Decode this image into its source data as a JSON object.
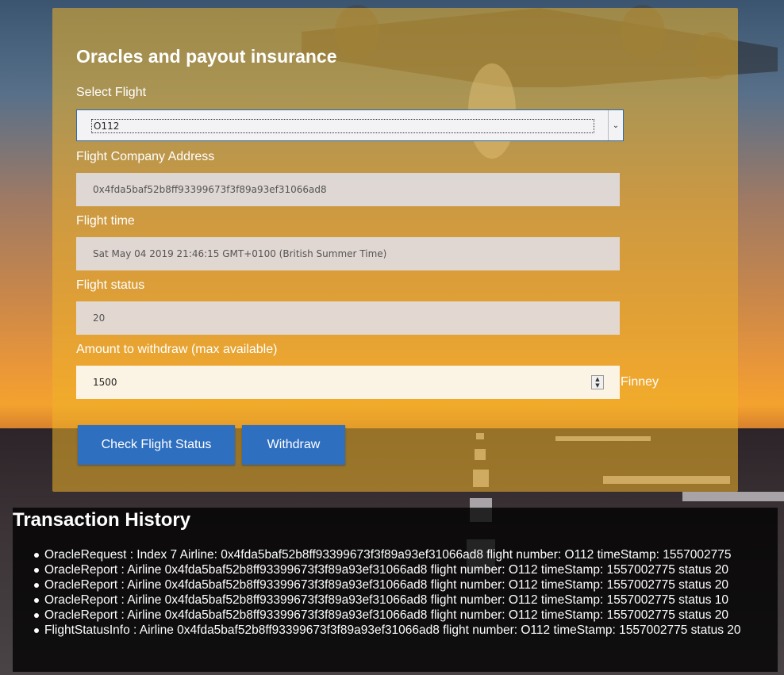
{
  "panel": {
    "title": "Oracles and payout insurance",
    "select_flight_label": "Select Flight",
    "select_flight_value": "O112",
    "company_address_label": "Flight Company Address",
    "company_address_value": "0x4fda5baf52b8ff93399673f3f89a93ef31066ad8",
    "flight_time_label": "Flight time",
    "flight_time_value": "Sat May 04 2019 21:46:15 GMT+0100 (British Summer Time)",
    "flight_status_label": "Flight status",
    "flight_status_value": "20",
    "amount_label": "Amount to withdraw (max available)",
    "amount_value": "1500",
    "amount_unit": "Finney",
    "check_button_label": "Check Flight Status",
    "withdraw_button_label": "Withdraw"
  },
  "history": {
    "title": "Transaction History",
    "entries": [
      {
        "event": "OracleRequest",
        "text": " : Index 7 Airline: 0x4fda5baf52b8ff93399673f3f89a93ef31066ad8 flight number: O112 timeStamp: 1557002775"
      },
      {
        "event": "OracleReport",
        "text": " : Airline 0x4fda5baf52b8ff93399673f3f89a93ef31066ad8 flight number: O112 timeStamp: 1557002775 status 20"
      },
      {
        "event": "OracleReport",
        "text": " : Airline 0x4fda5baf52b8ff93399673f3f89a93ef31066ad8 flight number: O112 timeStamp: 1557002775 status 20"
      },
      {
        "event": "OracleReport",
        "text": " : Airline 0x4fda5baf52b8ff93399673f3f89a93ef31066ad8 flight number: O112 timeStamp: 1557002775 status 10"
      },
      {
        "event": "OracleReport",
        "text": " : Airline 0x4fda5baf52b8ff93399673f3f89a93ef31066ad8 flight number: O112 timeStamp: 1557002775 status 20"
      },
      {
        "event": "FlightStatusInfo",
        "text": " : Airline 0x4fda5baf52b8ff93399673f3f89a93ef31066ad8 flight number: O112 timeStamp: 1557002775 status 20"
      }
    ]
  },
  "colors": {
    "panel_overlay": "#eeb228",
    "button": "#2e6fc0",
    "history_background": "#000000"
  },
  "icons": {
    "select_arrow": "chevron-down-icon",
    "spinner": "spinner-arrows-icon"
  }
}
